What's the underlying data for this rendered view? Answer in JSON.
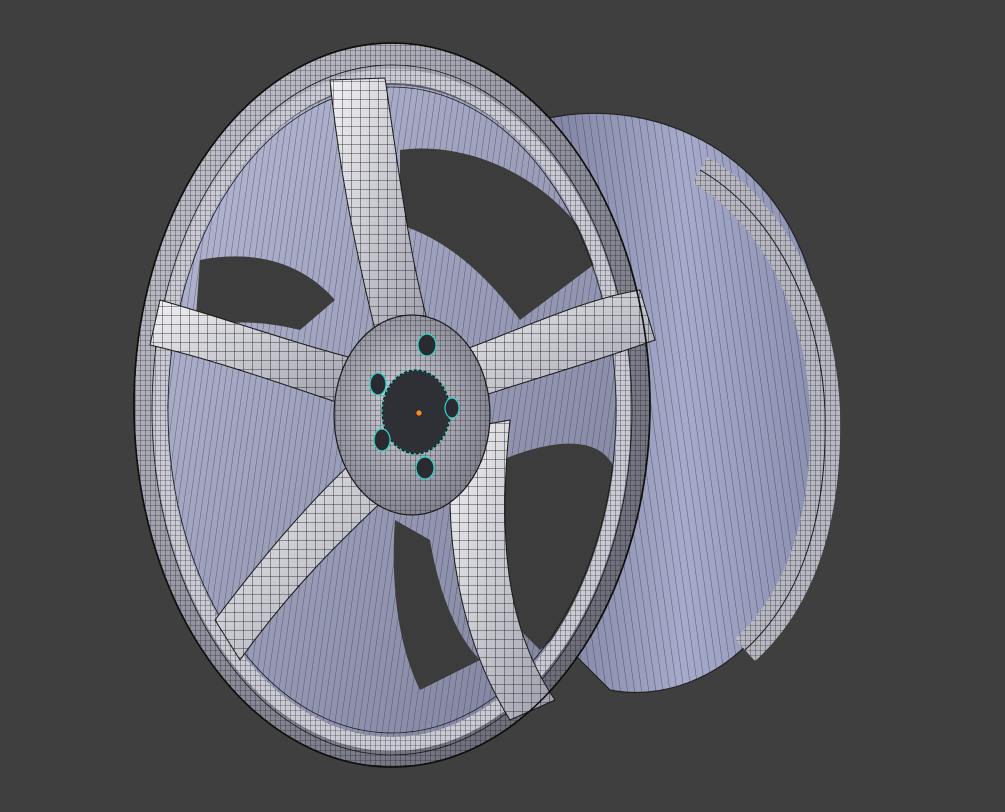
{
  "viewport": {
    "background_color": "#3f3f3f",
    "mode": "edit-mode-wireframe-overlay"
  },
  "object": {
    "kind": "wheel-rim-mesh",
    "spoke_count": 5,
    "lug_hole_count": 5,
    "colors": {
      "face_light": "#e4e4ea",
      "face_mid": "#a9aab8",
      "face_dark": "#6e6f80",
      "barrel": "#a4a8c8",
      "barrel_dark": "#7e82a4",
      "wire": "#111111",
      "selected_vertex": "#2fd6c8",
      "origin": "#ff8a1e"
    }
  }
}
